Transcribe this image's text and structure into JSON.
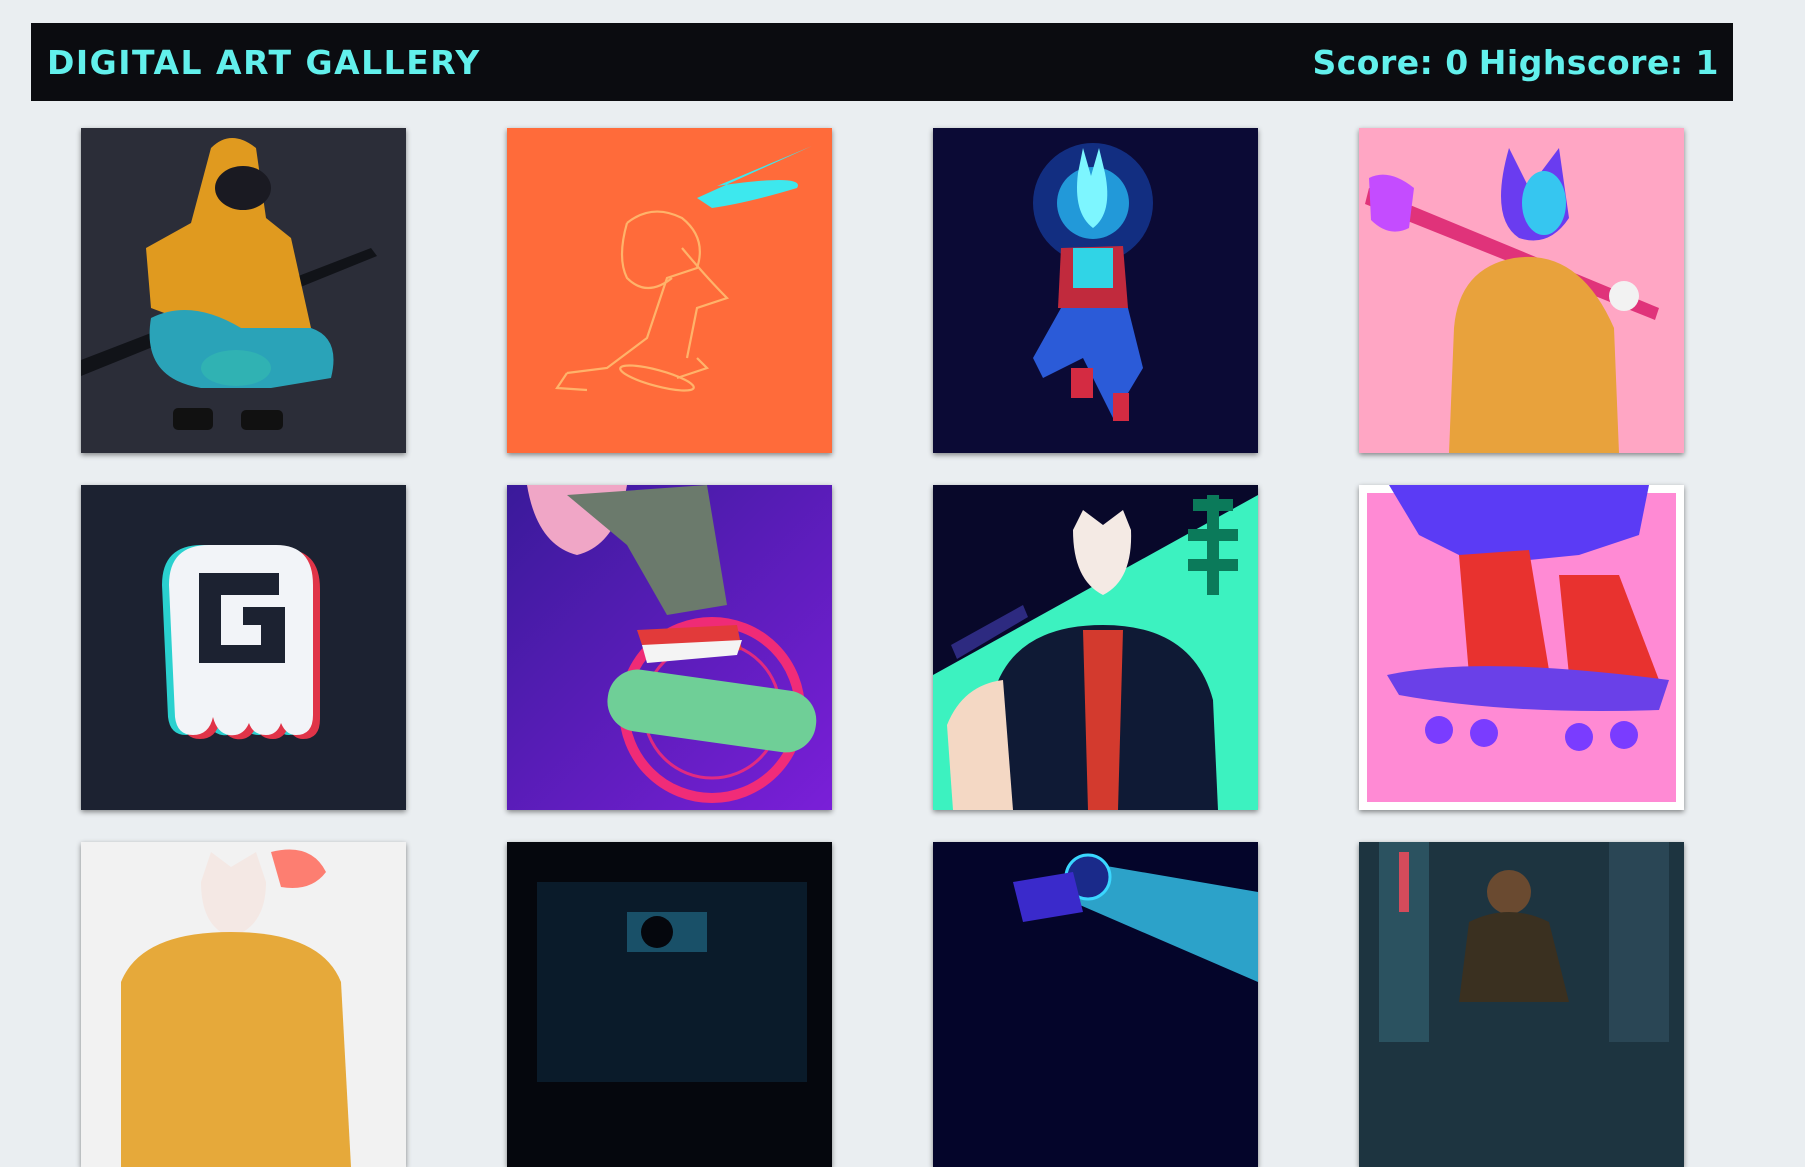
{
  "header": {
    "title": "DIGITAL ART GALLERY",
    "score_text": "Score: 0",
    "highscore_text": "Highscore: 1"
  },
  "colors": {
    "page_background": "#eaeef1",
    "header_background": "#0b0c10",
    "accent": "#62f0ec"
  },
  "gallery": {
    "cards": [
      {
        "artwork": "hooded-samurai-crouching",
        "background": "#2b2d38"
      },
      {
        "artwork": "skater-sketch-on-orange",
        "background": "#ff6b3a"
      },
      {
        "artwork": "neon-fox-mask-figure",
        "background": "#0b0a35"
      },
      {
        "artwork": "oni-with-bat-on-pink",
        "background": "#ffa6c4"
      },
      {
        "artwork": "glitch-ghost-logo",
        "background": "#1c2231"
      },
      {
        "artwork": "kickflip-purple-night",
        "background": "#5a1fc0"
      },
      {
        "artwork": "fox-mask-tokyo-jacket",
        "background": "#08082a"
      },
      {
        "artwork": "red-sneakers-skateboard",
        "background": "#ff8ad4"
      },
      {
        "artwork": "fox-mask-yellow-hoodie",
        "background": "#f2f2f2"
      },
      {
        "artwork": "dark-alley-silhouette",
        "background": "#05070d"
      },
      {
        "artwork": "neon-rider-helmet",
        "background": "#04052a"
      },
      {
        "artwork": "rainy-city-street",
        "background": "#1d3440"
      }
    ]
  }
}
